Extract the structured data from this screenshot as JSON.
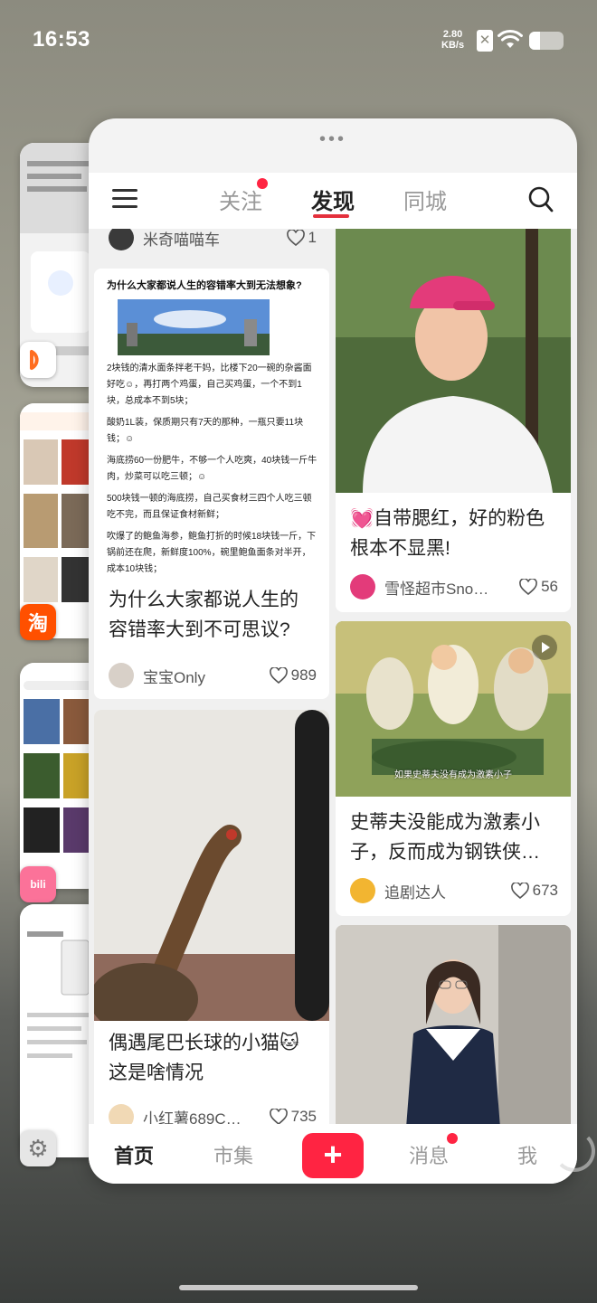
{
  "status_bar": {
    "time": "16:53",
    "net_speed_value": "2.80",
    "net_speed_unit": "KB/s",
    "sim_label": "✕"
  },
  "background_apps": [
    {
      "name": "didi",
      "icon_char": "D",
      "color": "#ff6d1f"
    },
    {
      "name": "taobao",
      "icon_char": "淘",
      "color": "#ff5000"
    },
    {
      "name": "bilibili",
      "icon_char": "bili",
      "color": "#fb7299"
    },
    {
      "name": "settings",
      "icon_char": "⚙",
      "color": "#8a8a8a"
    }
  ],
  "app": {
    "menu_icon": "hamburger-icon",
    "tabs": [
      {
        "label": "关注",
        "active": false,
        "has_dot": true
      },
      {
        "label": "发现",
        "active": true,
        "has_dot": false
      },
      {
        "label": "同城",
        "active": false,
        "has_dot": false
      }
    ],
    "search_icon": "search-icon",
    "accent_color": "#ff2442"
  },
  "feed": {
    "left": [
      {
        "partial_author": "米奇喵喵车",
        "partial_likes": "1",
        "doc_title": "为什么大家都说人生的容错率大到无法想象?",
        "doc_lines": [
          "2块钱的清水面条拌老干妈，比楼下20一碗的杂酱面好吃☺，再打两个鸡蛋，自己买鸡蛋，一个不到1块，总成本不到5块；",
          "酸奶1L装，保质期只有7天的那种，一瓶只要11块钱；☺",
          "海底捞60一份肥牛，不够一个人吃爽，40块钱一斤牛肉，炒菜可以吃三顿；☺",
          "500块钱一顿的海底捞，自己买食材三四个人吃三顿吃不完，而且保证食材新鲜；",
          "吹爆了的鲍鱼海参，鲍鱼打折的时候18块钱一斤，下锅前还在爬，新鲜度100%，碗里鲍鱼面条对半开，成本10块钱；"
        ],
        "title": "为什么大家都说人生的容错率大到不可思议?",
        "author": "宝宝Only",
        "likes": "989"
      },
      {
        "title": "偶遇尾巴长球的小猫🐱这是啥情况",
        "author": "小红薯689C…",
        "likes": "735"
      }
    ],
    "right": [
      {
        "title": "💓自带腮红，好的粉色根本不显黑!",
        "author": "雪怪超市Sno…",
        "likes": "56"
      },
      {
        "video_caption": "如果史蒂夫没有成为激素小子",
        "title": "史蒂夫没能成为激素小子，反而成为钢铁侠…",
        "author": "追剧达人",
        "likes": "673"
      },
      {
        "title": "",
        "author": "",
        "likes": ""
      }
    ]
  },
  "bottom_nav": {
    "items": [
      {
        "label": "首页",
        "active": true
      },
      {
        "label": "市集",
        "active": false
      },
      {
        "label": "消息",
        "active": false,
        "has_dot": true
      },
      {
        "label": "我",
        "active": false
      }
    ],
    "plus_label": "+"
  }
}
